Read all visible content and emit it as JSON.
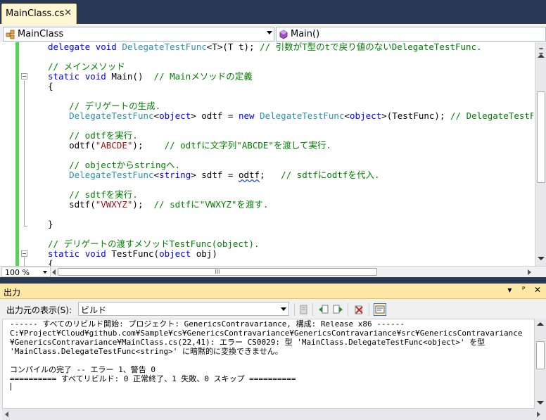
{
  "tab": {
    "label": "MainClass.cs",
    "close": "✕"
  },
  "nav": {
    "class_name": "MainClass",
    "member_name": "Main()"
  },
  "code_lines": [
    [
      [
        "kw",
        "delegate "
      ],
      [
        "kw",
        "void "
      ],
      [
        "ty",
        "DelegateTestFunc"
      ],
      [
        "tx",
        "<T>(T t); "
      ],
      [
        "cm",
        "// 引数がT型のtで戻り値のないDelegateTestFunc."
      ]
    ],
    [],
    [
      [
        "cm",
        "// メインメソッド"
      ]
    ],
    [
      [
        "kw",
        "static "
      ],
      [
        "kw",
        "void "
      ],
      [
        "tx",
        "Main()  "
      ],
      [
        "cm",
        "// Mainメソッドの定義"
      ]
    ],
    [
      [
        "tx",
        "{"
      ]
    ],
    [],
    [
      [
        "tx",
        "    "
      ],
      [
        "cm",
        "// デリゲートの生成."
      ]
    ],
    [
      [
        "tx",
        "    "
      ],
      [
        "ty",
        "DelegateTestFunc"
      ],
      [
        "tx",
        "<"
      ],
      [
        "kw",
        "object"
      ],
      [
        "tx",
        "> odtf = "
      ],
      [
        "kw",
        "new "
      ],
      [
        "ty",
        "DelegateTestFunc"
      ],
      [
        "tx",
        "<"
      ],
      [
        "kw",
        "object"
      ],
      [
        "tx",
        ">(TestFunc); "
      ],
      [
        "cm",
        "// DelegateTestFunc<obj"
      ]
    ],
    [],
    [
      [
        "tx",
        "    "
      ],
      [
        "cm",
        "// odtfを実行."
      ]
    ],
    [
      [
        "tx",
        "    odtf("
      ],
      [
        "st",
        "\"ABCDE\""
      ],
      [
        "tx",
        ");    "
      ],
      [
        "cm",
        "// odtfに文字列\"ABCDE\"を渡して実行."
      ]
    ],
    [],
    [
      [
        "tx",
        "    "
      ],
      [
        "cm",
        "// objectからstringへ."
      ]
    ],
    [
      [
        "tx",
        "    "
      ],
      [
        "ty",
        "DelegateTestFunc"
      ],
      [
        "tx",
        "<"
      ],
      [
        "kw",
        "string"
      ],
      [
        "tx",
        "> sdtf = "
      ],
      [
        "sq",
        "odtf"
      ],
      [
        "tx",
        ";   "
      ],
      [
        "cm",
        "// sdtfにodtfを代入."
      ]
    ],
    [],
    [
      [
        "tx",
        "    "
      ],
      [
        "cm",
        "// sdtfを実行."
      ]
    ],
    [
      [
        "tx",
        "    sdtf("
      ],
      [
        "st",
        "\"VWXYZ\""
      ],
      [
        "tx",
        ");  "
      ],
      [
        "cm",
        "// sdtfに\"VWXYZ\"を渡す."
      ]
    ],
    [],
    [
      [
        "tx",
        "}"
      ]
    ],
    [],
    [
      [
        "cm",
        "// デリゲートの渡すメソッドTestFunc(object)."
      ]
    ],
    [
      [
        "kw",
        "static "
      ],
      [
        "kw",
        "void "
      ],
      [
        "tx",
        "TestFunc("
      ],
      [
        "kw",
        "object "
      ],
      [
        "tx",
        "obj)"
      ]
    ],
    [
      [
        "tx",
        "{"
      ]
    ]
  ],
  "editor": {
    "zoom": "100 %",
    "hscroll_grip": "III"
  },
  "output": {
    "title": "出力",
    "title_buttons": [
      "▾",
      "ᴾ",
      "✕"
    ],
    "source_label": "出力元の表示(S):",
    "source_value": "ビルド",
    "lines": [
      "------ すべてのリビルド開始: プロジェクト: GenericsContravariance, 構成: Release x86 ------",
      "C:¥Project¥Cloud¥github.com¥Sample¥cs¥GenericsContravariance¥GenericsContravariance¥src¥GenericsContravariance",
      "¥GenericsContravariance¥MainClass.cs(22,41): エラー CS0029: 型 'MainClass.DelegateTestFunc<object>' を型",
      "'MainClass.DelegateTestFunc<string>' に暗黙的に変換できません。",
      "",
      "コンパイルの完了 -- エラー 1、警告 0",
      "========== すべてリビルド: 0 正常終了、1 失敗、0 スキップ =========="
    ]
  },
  "colors": {
    "keyword": "#0000ff",
    "type": "#2b91af",
    "comment": "#008000",
    "string": "#a31515",
    "frame": "#293955",
    "active_tab": "#fff6d3",
    "panel_title": "#ffe8a6",
    "change_bar": "#57d15a"
  }
}
